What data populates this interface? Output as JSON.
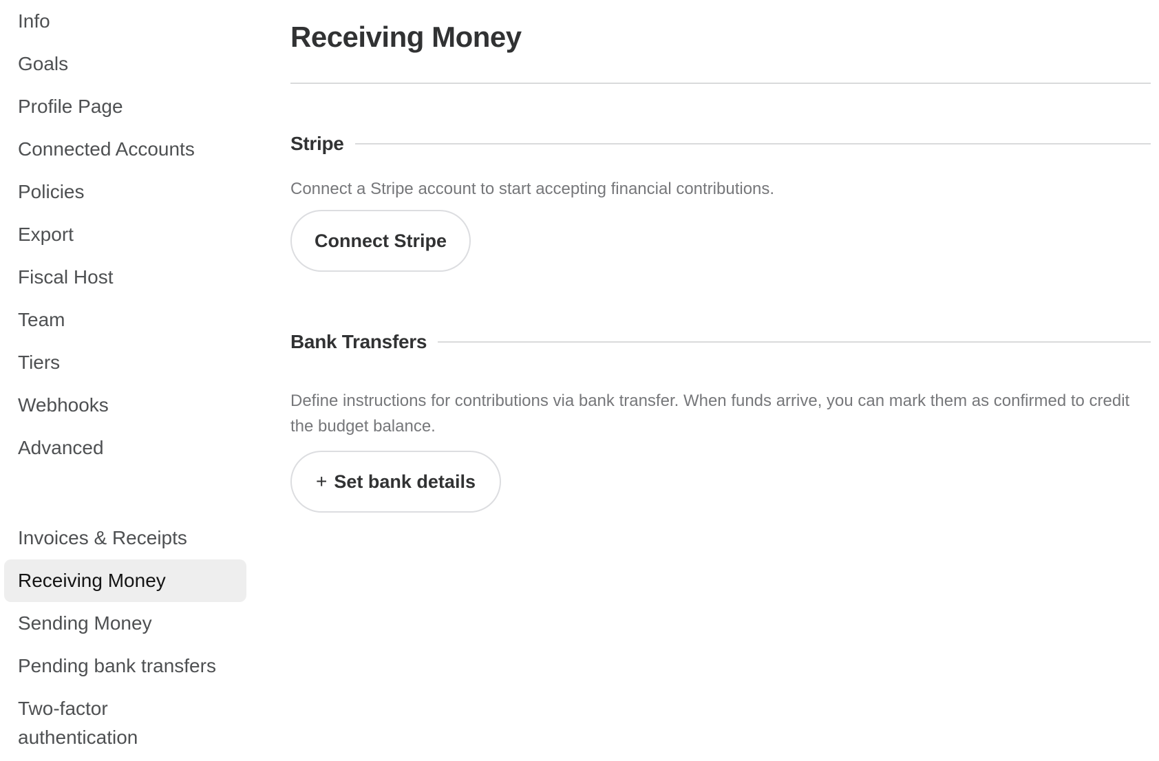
{
  "sidebar": {
    "group1": [
      {
        "label": "Info"
      },
      {
        "label": "Goals"
      },
      {
        "label": "Profile Page"
      },
      {
        "label": "Connected Accounts"
      },
      {
        "label": "Policies"
      },
      {
        "label": "Export"
      },
      {
        "label": "Fiscal Host"
      },
      {
        "label": "Team"
      },
      {
        "label": "Tiers"
      },
      {
        "label": "Webhooks"
      },
      {
        "label": "Advanced"
      }
    ],
    "group2": [
      {
        "label": "Invoices & Receipts"
      },
      {
        "label": "Receiving Money",
        "active": true
      },
      {
        "label": "Sending Money"
      },
      {
        "label": "Pending bank transfers"
      },
      {
        "label": "Two-factor authentication"
      }
    ]
  },
  "main": {
    "title": "Receiving Money",
    "stripe": {
      "heading": "Stripe",
      "description": "Connect a Stripe account to start accepting financial contributions.",
      "button_label": "Connect Stripe"
    },
    "bank": {
      "heading": "Bank Transfers",
      "description": "Define instructions for contributions via bank transfer. When funds arrive, you can mark them as confirmed to credit the budget balance.",
      "button_icon": "plus-icon",
      "button_icon_glyph": "+",
      "button_label": "Set bank details"
    }
  }
}
